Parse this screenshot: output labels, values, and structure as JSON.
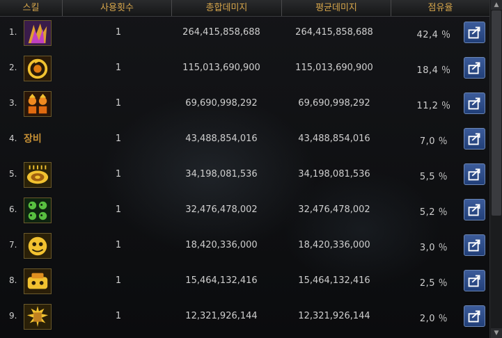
{
  "header": {
    "skill": "스킬",
    "uses": "사용횟수",
    "total_damage": "총합데미지",
    "avg_damage": "평균데미지",
    "share": "점유율"
  },
  "rows": [
    {
      "rank": "1.",
      "icon": "skill-icon-1",
      "label": "",
      "uses": "1",
      "total": "264,415,858,688",
      "avg": "264,415,858,688",
      "share": "42,4 ％"
    },
    {
      "rank": "2.",
      "icon": "skill-icon-2",
      "label": "",
      "uses": "1",
      "total": "115,013,690,900",
      "avg": "115,013,690,900",
      "share": "18,4 ％"
    },
    {
      "rank": "3.",
      "icon": "skill-icon-3",
      "label": "",
      "uses": "1",
      "total": "69,690,998,292",
      "avg": "69,690,998,292",
      "share": "11,2 ％"
    },
    {
      "rank": "4.",
      "icon": "equipment-text",
      "label": "장비",
      "uses": "1",
      "total": "43,488,854,016",
      "avg": "43,488,854,016",
      "share": "7,0 ％"
    },
    {
      "rank": "5.",
      "icon": "skill-icon-5",
      "label": "",
      "uses": "1",
      "total": "34,198,081,536",
      "avg": "34,198,081,536",
      "share": "5,5 ％"
    },
    {
      "rank": "6.",
      "icon": "skill-icon-6",
      "label": "",
      "uses": "1",
      "total": "32,476,478,002",
      "avg": "32,476,478,002",
      "share": "5,2 ％"
    },
    {
      "rank": "7.",
      "icon": "skill-icon-7",
      "label": "",
      "uses": "1",
      "total": "18,420,336,000",
      "avg": "18,420,336,000",
      "share": "3,0 ％"
    },
    {
      "rank": "8.",
      "icon": "skill-icon-8",
      "label": "",
      "uses": "1",
      "total": "15,464,132,416",
      "avg": "15,464,132,416",
      "share": "2,5 ％"
    },
    {
      "rank": "9.",
      "icon": "skill-icon-9",
      "label": "",
      "uses": "1",
      "total": "12,321,926,144",
      "avg": "12,321,926,144",
      "share": "2,0 ％"
    }
  ],
  "colors": {
    "header_text": "#d7a64b",
    "button": "#2c4c88",
    "icon_gold": "#f2c230"
  }
}
